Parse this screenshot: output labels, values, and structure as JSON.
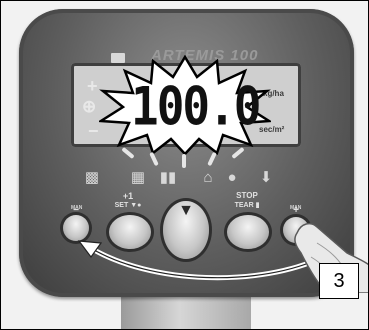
{
  "device": {
    "brand_name": "ARTEMIS 100",
    "display_value": "100.0",
    "unit_top": "kg/ha",
    "unit_bottom": "sec/m²"
  },
  "left_indicators": {
    "plus": "+",
    "target": "⊕",
    "minus": "−"
  },
  "buttons": [
    {
      "id": "minus",
      "top_label": "MAN",
      "label": "−"
    },
    {
      "id": "plus-one",
      "top_label": "+1",
      "label": "SET ▼●"
    },
    {
      "id": "down",
      "top_label": "",
      "label": "▼"
    },
    {
      "id": "stop",
      "top_label": "STOP",
      "label": "TEAR ▮"
    },
    {
      "id": "plus",
      "top_label": "MAN",
      "label": "+"
    }
  ],
  "callout": {
    "step": "3"
  },
  "colors": {
    "housing": "#5e5e5e",
    "lcd": "#cfcfcf",
    "key": "#c6c6c6"
  }
}
